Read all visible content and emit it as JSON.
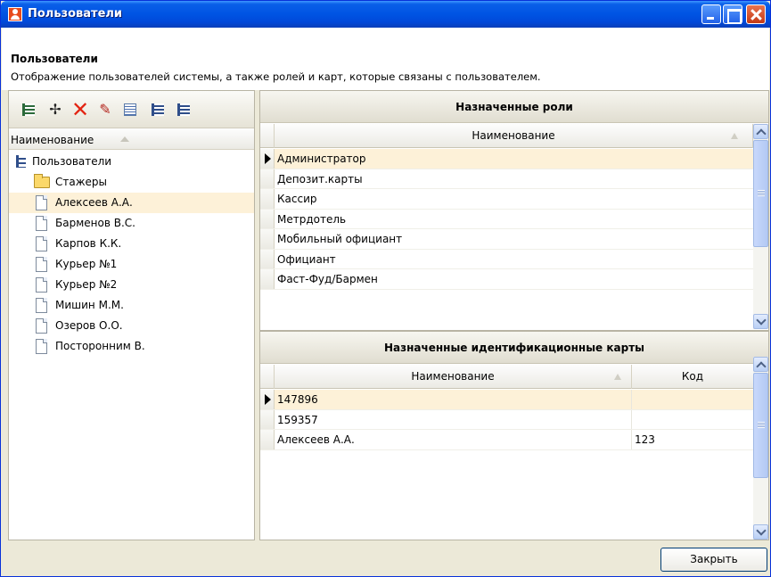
{
  "window": {
    "title": "Пользователи"
  },
  "header": {
    "title": "Пользователи",
    "description": "Отображение пользователей системы, а также ролей и карт, которые связаны с пользователем."
  },
  "toolbar": {
    "icons": [
      "add-group-icon",
      "add-icon",
      "delete-icon",
      "edit-icon",
      "properties-icon",
      "expand-tree-icon",
      "collapse-tree-icon"
    ],
    "add_glyph": "✢",
    "delete_glyph": "✕",
    "edit_glyph": "✎"
  },
  "users_list": {
    "column_header": "Наименование",
    "root": "Пользователи",
    "folder": "Стажеры",
    "items": [
      {
        "label": "Алексеев А.А."
      },
      {
        "label": "Барменов В.С."
      },
      {
        "label": "Карпов К.К."
      },
      {
        "label": "Курьер №1"
      },
      {
        "label": "Курьер №2"
      },
      {
        "label": "Мишин М.М."
      },
      {
        "label": "Озеров О.О."
      },
      {
        "label": "Посторонним В."
      }
    ],
    "selected_index": 0
  },
  "roles_panel": {
    "title": "Назначенные роли",
    "column_header": "Наименование",
    "rows": [
      "Администратор",
      "Депозит.карты",
      "Кассир",
      "Метрдотель",
      "Мобильный официант",
      "Официант",
      "Фаст-Фуд/Бармен"
    ],
    "selected_index": 0
  },
  "cards_panel": {
    "title": "Назначенные идентификационные карты",
    "columns": [
      "Наименование",
      "Код"
    ],
    "rows": [
      {
        "name": "147896",
        "code": ""
      },
      {
        "name": "159357",
        "code": ""
      },
      {
        "name": "Алексеев А.А.",
        "code": "123"
      }
    ],
    "selected_index": 0
  },
  "footer": {
    "close_label": "Закрыть"
  },
  "colors": {
    "titlebar": "#0054e3",
    "selection": "#fdf1d8",
    "window_bg": "#ece9d8"
  }
}
